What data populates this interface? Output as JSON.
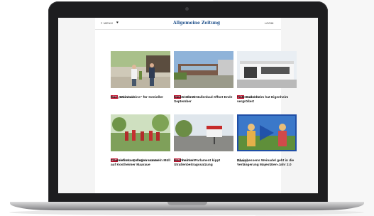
{
  "header": {
    "menu_label": "MENÜ",
    "logo_text": "Allgemeine Zeitung",
    "login_label": "LOGIN"
  },
  "cards": [
    {
      "badge": "plus",
      "location": "Bodenheim",
      "title": "Das „Weinmaleins“ für Genießer"
    },
    {
      "badge": "plus",
      "location": "Nieder-Olm",
      "title": "Nieder-Olmer Hallenbad öffnet Ende September"
    },
    {
      "badge": "plus",
      "location": "Bodenheim",
      "title": "TGM Bodenheim hat Eigenheim vergrößert"
    },
    {
      "badge": "plus",
      "location": "Amöneburg-Kostheim-Kastel",
      "title": "Chemiefirma-Kollegen sammeln Müll auf Kostheimer Maaraue"
    },
    {
      "badge": "plus",
      "location": "Hochheim",
      "title": "Hochheimer Parlament kippt Straßenbeitragssatzung"
    },
    {
      "badge": "",
      "location": "Anzeige",
      "title": "Rheinhessens Weinadel geht in die Verlängerung Majestäten-Jahr 2.0"
    }
  ],
  "colors": {
    "plus_badge": "#c4122f",
    "brand": "#1e4f8a",
    "video_overlay": "#1f4ea6"
  },
  "icons": {
    "menu": "hamburger-icon",
    "favorites": "heart-icon",
    "video": "play-icon"
  }
}
